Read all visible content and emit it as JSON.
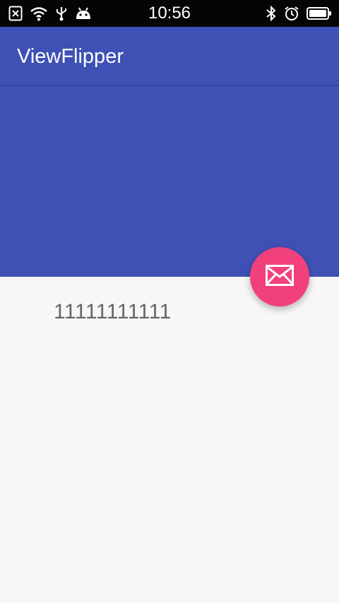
{
  "status_bar": {
    "time": "10:56",
    "left_icons": [
      "sim-error-icon",
      "wifi-icon",
      "usb-icon",
      "android-debug-icon"
    ],
    "right_icons": [
      "bluetooth-icon",
      "alarm-icon",
      "battery-icon"
    ]
  },
  "app_bar": {
    "title": "ViewFlipper"
  },
  "flipper": {
    "text": "11111111111"
  },
  "fab": {
    "icon": "mail-icon"
  },
  "colors": {
    "primary": "#3f51b5",
    "accent": "#f2407a",
    "background": "#f7f7f7",
    "status_bar": "#050505",
    "text": "#666666"
  }
}
